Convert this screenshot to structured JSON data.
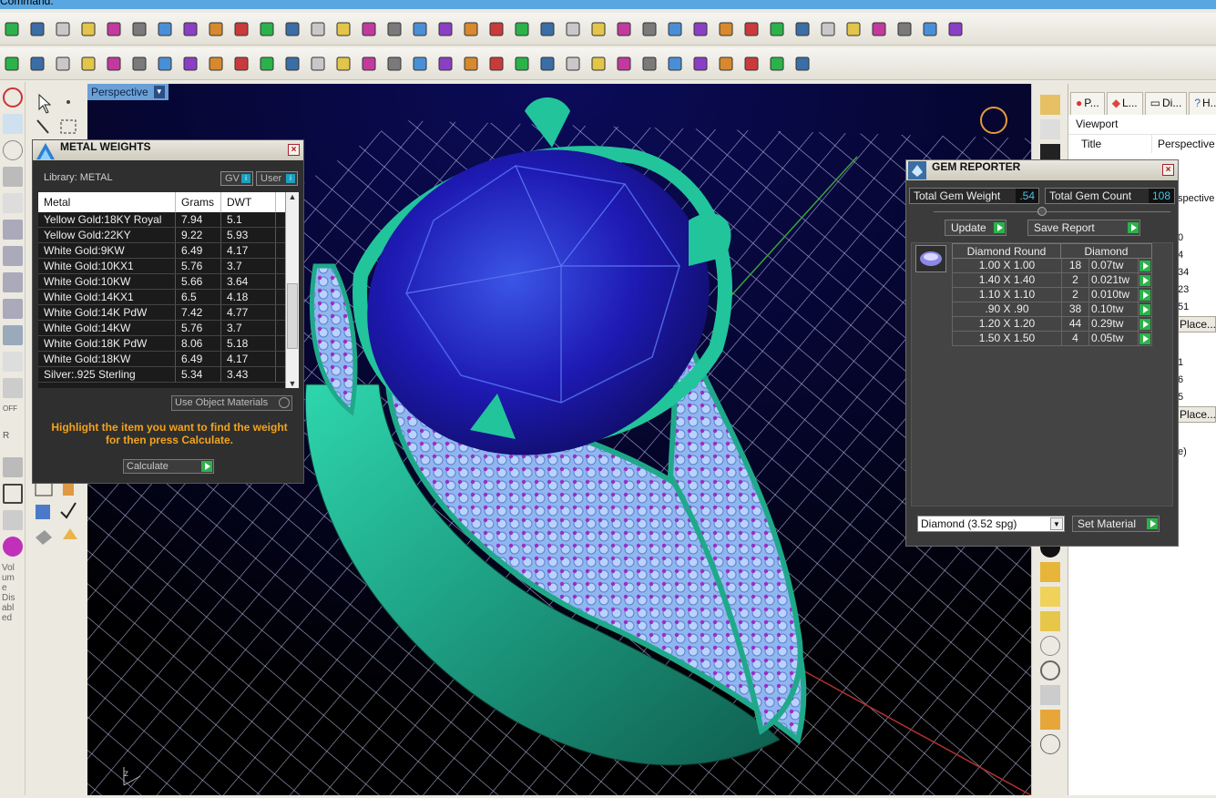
{
  "command_bar": {
    "label": "Command:"
  },
  "toolbar_top": {
    "icons": [
      "power-icon",
      "box-icon",
      "cube-icon",
      "ring-icon",
      "crown-icon",
      "prong-icon",
      "wire-icon",
      "chain-icon",
      "gem-icon",
      "bail-icon",
      "pendant-icon",
      "clasp-icon",
      "hook-icon",
      "bezel-icon",
      "channel-icon",
      "pave-icon",
      "grid-icon",
      "cancel-icon",
      "gallery-icon",
      "head-icon",
      "wrap-icon",
      "bracelet-icon",
      "dots-icon",
      "knot-icon",
      "hand-icon",
      "split-icon",
      "branch-icon",
      "eraser-icon",
      "star-icon",
      "sun-icon",
      "pentagon-icon",
      "comb-icon",
      "tiles-icon",
      "plate-icon",
      "ruler-icon",
      "cross-icon",
      "cap-icon",
      "gear-icon"
    ]
  },
  "toolbar_std": {
    "icons": [
      "new-icon",
      "open-icon",
      "save-icon",
      "print-icon",
      "export-icon",
      "cut-icon",
      "copy-icon",
      "paste-icon",
      "undo-icon",
      "pan-icon",
      "move-icon",
      "zoom-icon",
      "zoom-window-icon",
      "zoom-extents-icon",
      "zoom-selected-icon",
      "rotate-icon",
      "layout-icon",
      "car-icon",
      "render-icon",
      "circle-icon",
      "snap-icon",
      "bulb-icon",
      "lock-icon",
      "layer-icon",
      "color-icon",
      "sphere-icon",
      "shaded-icon",
      "render-sphere-icon",
      "pointer-icon",
      "settings-icon",
      "sel-icon",
      "help-icon"
    ]
  },
  "viewport": {
    "tab_label": "Perspective",
    "dropdown_glyph": "▼"
  },
  "left_column": {
    "labels": [
      "Vol",
      "um",
      "e",
      "Dis",
      "abl",
      "ed"
    ],
    "off_label": "OFF",
    "r_label": "R"
  },
  "metal_weights": {
    "title": "METAL WEIGHTS",
    "library_label": "Library: METAL",
    "gv_label": "GV",
    "user_label": "User",
    "columns": [
      "Metal",
      "Grams",
      "DWT"
    ],
    "rows": [
      [
        "Yellow Gold:18KY Royal",
        "7.94",
        "5.1"
      ],
      [
        "Yellow Gold:22KY",
        "9.22",
        "5.93"
      ],
      [
        "White Gold:9KW",
        "6.49",
        "4.17"
      ],
      [
        "White Gold:10KX1",
        "5.76",
        "3.7"
      ],
      [
        "White Gold:10KW",
        "5.66",
        "3.64"
      ],
      [
        "White Gold:14KX1",
        "6.5",
        "4.18"
      ],
      [
        "White Gold:14K PdW",
        "7.42",
        "4.77"
      ],
      [
        "White Gold:14KW",
        "5.76",
        "3.7"
      ],
      [
        "White Gold:18K PdW",
        "8.06",
        "5.18"
      ],
      [
        "White Gold:18KW",
        "6.49",
        "4.17"
      ],
      [
        "Silver:.925 Sterling",
        "5.34",
        "3.43"
      ]
    ],
    "use_object_materials": "Use Object Materials",
    "hint": "Highlight the item you want to find the weight for then press Calculate.",
    "calculate_label": "Calculate",
    "close_glyph": "×"
  },
  "gem_reporter": {
    "title": "GEM REPORTER",
    "total_weight_label": "Total Gem Weight",
    "total_weight_value": ".54",
    "total_count_label": "Total Gem Count",
    "total_count_value": "108",
    "update_label": "Update",
    "save_report_label": "Save Report",
    "col_shape": "Diamond Round",
    "col_material": "Diamond",
    "rows": [
      [
        "1.00 X 1.00",
        "18",
        "0.07tw"
      ],
      [
        "1.40 X 1.40",
        "2",
        "0.021tw"
      ],
      [
        "1.10 X 1.10",
        "2",
        "0.010tw"
      ],
      [
        ".90 X .90",
        "38",
        "0.10tw"
      ],
      [
        "1.20 X 1.20",
        "44",
        "0.29tw"
      ],
      [
        "1.50 X 1.50",
        "4",
        "0.05tw"
      ]
    ],
    "material_select": "Diamond    (3.52 spg)",
    "set_material_label": "Set Material",
    "close_glyph": "×"
  },
  "properties": {
    "tabs": [
      "P...",
      "L...",
      "Di...",
      "H..."
    ],
    "section": "Viewport",
    "title_label": "Title",
    "title_value": "Perspective",
    "partial_value": "spective",
    "values": [
      "0",
      "4",
      "34",
      "23",
      "51",
      "1",
      "6",
      "5",
      "e)"
    ],
    "place_label": "Place..."
  },
  "colors": {
    "accent": "#2bb24a",
    "metal": "#1fa98a",
    "gem": "#1e1ab4",
    "panel_bg": "#2f2f2f",
    "hint": "#f2a31c"
  }
}
